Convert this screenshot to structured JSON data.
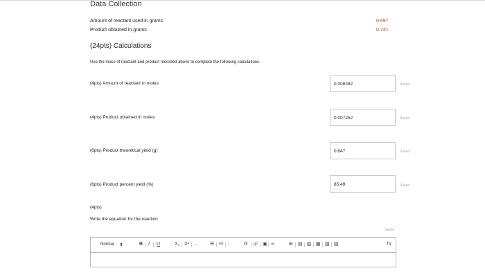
{
  "data_collection": {
    "title": "Data Collection",
    "rows": [
      {
        "label": "Amount of reactant used in grams",
        "value": "0.697"
      },
      {
        "label": "Product obtained in grams",
        "value": "0.741"
      }
    ]
  },
  "calculations": {
    "title": "(24pts) Calculations",
    "instructions": "Use the mass of reactant and product recorded above to complete the following calculations.",
    "questions": [
      {
        "label": "(4pts)  Amount of reactant in moles",
        "answer": "0.008282",
        "status": "Saved"
      },
      {
        "label": "(4pts)  Product obtained in moles",
        "answer": "0.007252",
        "status": "Saved"
      },
      {
        "label": "(6pts)  Product theoretical yield (g)",
        "answer": "0.847",
        "status": "Saved"
      },
      {
        "label": "(6pts)  Product percent yield (%)",
        "answer": "85.49",
        "status": "Saved"
      }
    ]
  },
  "equation": {
    "points": "(4pts)",
    "label": "Write the equation for the reaction",
    "status": "Saved",
    "editor": {
      "format_label": "Normal",
      "format_caret": "⬍",
      "bold": "B",
      "italic": "I",
      "underline": "U",
      "subscript": "X₂",
      "superscript": "X²",
      "arrow": "→",
      "ordered_list": "☰",
      "bullet_list": "☷",
      "align": "⫶",
      "formula": "fx",
      "link": "🔗",
      "image": "▣",
      "chain": "∞",
      "table": "⊞",
      "table_row": "▤",
      "table_col": "▥",
      "table_del": "▦",
      "table_merge": "▧",
      "table_split": "▨",
      "clear_format": "Tx"
    }
  }
}
